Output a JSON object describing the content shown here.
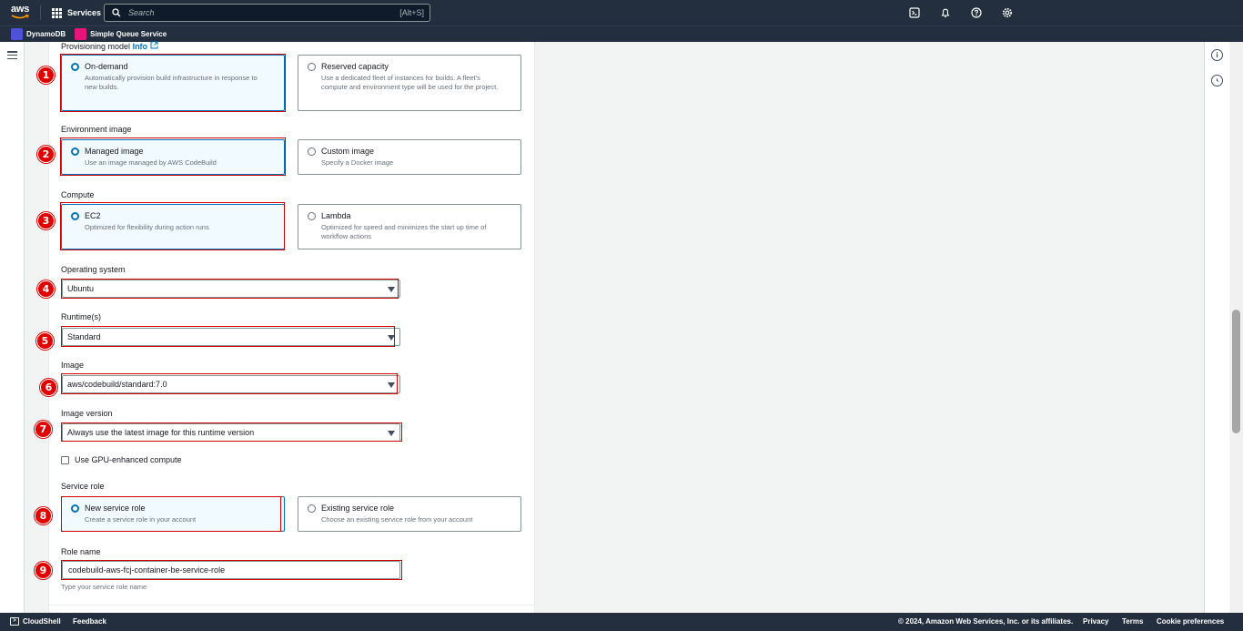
{
  "topnav": {
    "logo_text": "aws",
    "services_label": "Services",
    "search_placeholder": "Search",
    "search_shortcut": "[Alt+S]",
    "icons": [
      "cloudshell-icon",
      "bell-icon",
      "help-icon",
      "settings-icon"
    ]
  },
  "favorites": [
    {
      "label": "DynamoDB",
      "color": "#4d52d9"
    },
    {
      "label": "Simple Queue Service",
      "color": "#e7157b"
    }
  ],
  "form": {
    "provisioning": {
      "label": "Provisioning model",
      "info": "Info",
      "options": [
        {
          "title": "On-demand",
          "desc": "Automatically provision build infrastructure in response to new builds.",
          "selected": true
        },
        {
          "title": "Reserved capacity",
          "desc": "Use a dedicated fleet of instances for builds. A fleet's compute and environment type will be used for the project.",
          "selected": false
        }
      ]
    },
    "env_image": {
      "label": "Environment image",
      "options": [
        {
          "title": "Managed image",
          "desc": "Use an image managed by AWS CodeBuild",
          "selected": true
        },
        {
          "title": "Custom image",
          "desc": "Specify a Docker image",
          "selected": false
        }
      ]
    },
    "compute": {
      "label": "Compute",
      "options": [
        {
          "title": "EC2",
          "desc": "Optimized for flexibility during action runs",
          "selected": true
        },
        {
          "title": "Lambda",
          "desc": "Optimized for speed and minimizes the start up time of workflow actions",
          "selected": false
        }
      ]
    },
    "os": {
      "label": "Operating system",
      "value": "Ubuntu"
    },
    "runtime": {
      "label": "Runtime(s)",
      "value": "Standard"
    },
    "image": {
      "label": "Image",
      "value": "aws/codebuild/standard:7.0"
    },
    "image_version": {
      "label": "Image version",
      "value": "Always use the latest image for this runtime version"
    },
    "gpu": {
      "label": "Use GPU-enhanced compute",
      "checked": false
    },
    "service_role": {
      "label": "Service role",
      "options": [
        {
          "title": "New service role",
          "desc": "Create a service role in your account",
          "selected": true
        },
        {
          "title": "Existing service role",
          "desc": "Choose an existing service role from your account",
          "selected": false
        }
      ]
    },
    "role_name": {
      "label": "Role name",
      "value": "codebuild-aws-fcj-container-be-service-role",
      "hint": "Type your service role name"
    }
  },
  "annotations": [
    "1",
    "2",
    "3",
    "4",
    "5",
    "6",
    "7",
    "8",
    "9"
  ],
  "footer": {
    "cloudshell": "CloudShell",
    "feedback": "Feedback",
    "copyright": "© 2024, Amazon Web Services, Inc. or its affiliates.",
    "privacy": "Privacy",
    "terms": "Terms",
    "cookie": "Cookie preferences"
  }
}
